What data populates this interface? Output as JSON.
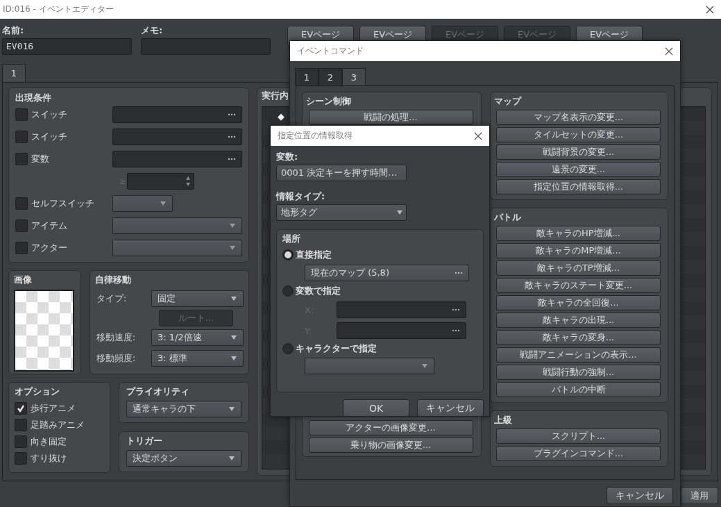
{
  "window": {
    "title": "ID:016 - イベントエディター"
  },
  "name": {
    "label": "名前:",
    "value": "EV016"
  },
  "memo": {
    "label": "メモ:"
  },
  "ev_pages": [
    {
      "label": "EVページ",
      "disabled": false
    },
    {
      "label": "EVページ",
      "disabled": false
    },
    {
      "label": "EVページ",
      "disabled": true
    },
    {
      "label": "EVページ",
      "disabled": true
    },
    {
      "label": "EVページ",
      "disabled": false
    }
  ],
  "page_tabs": [
    {
      "label": "1",
      "selected": true
    }
  ],
  "conditions": {
    "title": "出現条件",
    "items": [
      {
        "kind": "picker",
        "label": "スイッチ",
        "checked": false
      },
      {
        "kind": "picker",
        "label": "スイッチ",
        "checked": false
      },
      {
        "kind": "picker",
        "label": "変数",
        "checked": false
      },
      {
        "kind": "compare",
        "symbol": "≥"
      },
      {
        "kind": "short-select",
        "label": "セルフスイッチ",
        "checked": false
      },
      {
        "kind": "select",
        "label": "アイテム",
        "checked": false
      },
      {
        "kind": "select",
        "label": "アクター",
        "checked": false
      }
    ]
  },
  "image": {
    "title": "画像"
  },
  "movement": {
    "title": "自律移動",
    "rows": [
      {
        "kind": "select",
        "label": "タイプ:",
        "value": "固定"
      },
      {
        "kind": "button",
        "label": "ルート...",
        "disabled": true
      },
      {
        "kind": "select",
        "label": "移動速度:",
        "value": "3: 1/2倍速"
      },
      {
        "kind": "select",
        "label": "移動頻度:",
        "value": "3: 標準"
      }
    ]
  },
  "options": {
    "title": "オプション",
    "items": [
      {
        "label": "歩行アニメ",
        "checked": true
      },
      {
        "label": "足踏みアニメ",
        "checked": false
      },
      {
        "label": "向き固定",
        "checked": false
      },
      {
        "label": "すり抜け",
        "checked": false
      }
    ]
  },
  "priority": {
    "title": "プライオリティ",
    "value": "通常キャラの下"
  },
  "trigger": {
    "title": "トリガー",
    "value": "決定ボタン"
  },
  "contents": {
    "title": "実行内",
    "marker": "◆"
  },
  "buttons": [
    "適用"
  ],
  "command_dialog": {
    "title": "イベントコマンド",
    "tabs": [
      {
        "label": "1",
        "selected": false
      },
      {
        "label": "2",
        "selected": false
      },
      {
        "label": "3",
        "selected": true
      }
    ],
    "scene_group": {
      "title": "シーン制御",
      "top_buttons": [
        "戦闘の処理..."
      ],
      "bottom_buttons": [
        "アクターの画像変更...",
        "乗り物の画像変更..."
      ]
    },
    "groups": [
      {
        "title": "マップ",
        "buttons": [
          "マップ名表示の変更...",
          "タイルセットの変更...",
          "戦闘背景の変更...",
          "遠景の変更...",
          "指定位置の情報取得..."
        ]
      },
      {
        "title": "バトル",
        "buttons": [
          "敵キャラのHP増減...",
          "敵キャラのMP増減...",
          "敵キャラのTP増減...",
          "敵キャラのステート変更...",
          "敵キャラの全回復...",
          "敵キャラの出現...",
          "敵キャラの変身...",
          "戦闘アニメーションの表示...",
          "戦闘行動の強制...",
          "バトルの中断"
        ]
      },
      {
        "title": "上級",
        "buttons": [
          "スクリプト...",
          "プラグインコマンド..."
        ]
      }
    ],
    "buttons": [
      "キャンセル"
    ]
  },
  "info_dialog": {
    "title": "指定位置の情報取得",
    "variable": {
      "label": "変数:",
      "value": "0001 決定キーを押す時間…"
    },
    "info_type": {
      "label": "情報タイプ:",
      "value": "地形タグ"
    },
    "location": {
      "title": "場所",
      "options": [
        {
          "kind": "direct",
          "label": "直接指定",
          "selected": true,
          "value": "現在のマップ (5,8)"
        },
        {
          "kind": "variables",
          "label": "変数で指定",
          "selected": false,
          "x_label": "X:",
          "y_label": "Y:"
        },
        {
          "kind": "character",
          "label": "キャラクターで指定",
          "selected": false
        }
      ]
    },
    "buttons": [
      "OK",
      "キャンセル"
    ]
  }
}
